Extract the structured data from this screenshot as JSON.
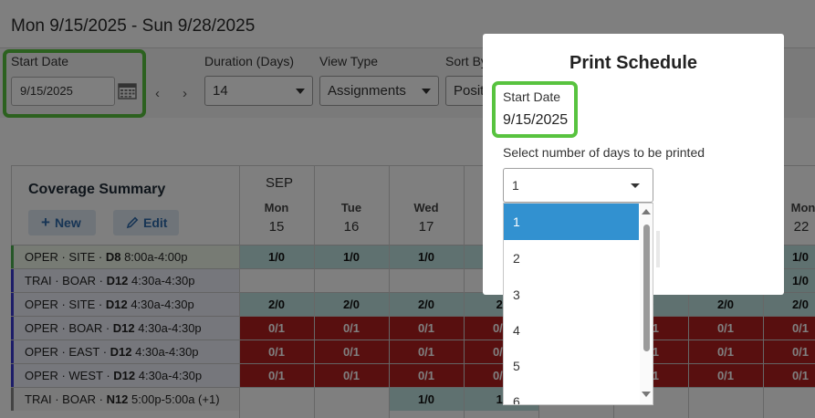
{
  "header": {
    "date_range": "Mon 9/15/2025  -  Sun 9/28/2025"
  },
  "filters": {
    "start_date_label": "Start Date",
    "start_date_value": "9/15/2025",
    "duration_label": "Duration (Days)",
    "duration_value": "14",
    "view_type_label": "View Type",
    "view_type_value": "Assignments",
    "sort_label": "Sort By",
    "sort_value": "Posit",
    "prev_arrow": "‹",
    "next_arrow": "›"
  },
  "coverage": {
    "title": "Coverage Summary",
    "new_label": "New",
    "edit_label": "Edit",
    "month": "SEP",
    "days": [
      {
        "dow": "Mon",
        "num": "15"
      },
      {
        "dow": "Tue",
        "num": "16"
      },
      {
        "dow": "Wed",
        "num": "17"
      },
      {
        "dow": "Mon",
        "num": "22"
      }
    ],
    "rows": [
      {
        "pre": "OPER · SITE · ",
        "code": "D8",
        "time": " 8:00a-4:00p",
        "bar": "#4caf50",
        "cells": [
          "1/0",
          "1/0",
          "1/0",
          "",
          "",
          "",
          "",
          "1/0"
        ],
        "status": "teal"
      },
      {
        "pre": "TRAI · BOAR · ",
        "code": "D12",
        "time": " 4:30a-4:30p",
        "bar": "#3a3ad0",
        "cells": [
          "",
          "",
          "",
          "",
          "",
          "",
          "",
          "1/0"
        ],
        "status": "mixed"
      },
      {
        "pre": "OPER · SITE · ",
        "code": "D12",
        "time": " 4:30a-4:30p",
        "bar": "#3a3ad0",
        "cells": [
          "2/0",
          "2/0",
          "2/0",
          "2/",
          "",
          "0",
          "2/0",
          "2/0"
        ],
        "status": "teal"
      },
      {
        "pre": "OPER · BOAR · ",
        "code": "D12",
        "time": " 4:30a-4:30p",
        "bar": "#3a3ad0",
        "cells": [
          "0/1",
          "0/1",
          "0/1",
          "0/1",
          "",
          "0/1",
          "0/1",
          "0/1"
        ],
        "status": "red"
      },
      {
        "pre": "OPER · EAST · ",
        "code": "D12",
        "time": " 4:30a-4:30p",
        "bar": "#3a3ad0",
        "cells": [
          "0/1",
          "0/1",
          "0/1",
          "0/1",
          "",
          "0/1",
          "0/1",
          "0/1"
        ],
        "status": "red"
      },
      {
        "pre": "OPER · WEST · ",
        "code": "D12",
        "time": " 4:30a-4:30p",
        "bar": "#3a3ad0",
        "cells": [
          "0/1",
          "0/1",
          "0/1",
          "0/1",
          "",
          "0/1",
          "0/1",
          "0/1"
        ],
        "status": "red"
      },
      {
        "pre": "TRAI · BOAR · ",
        "code": "N12",
        "time": " 5:00p-5:00a (+1)",
        "bar": "#888888",
        "cells": [
          "",
          "",
          "1/0",
          "1/",
          "",
          "",
          "",
          ""
        ],
        "status": "mixed"
      }
    ]
  },
  "modal": {
    "title": "Print Schedule",
    "start_date_label": "Start Date",
    "start_date_value": "9/15/2025",
    "days_prompt": "Select number of days to be printed",
    "days_selected": "1",
    "options": [
      "1",
      "2",
      "3",
      "4",
      "5",
      "6"
    ]
  },
  "colors": {
    "teal_cell": "#bfe3e0",
    "red_cell": "#b01f1f",
    "highlight": "#58c33f",
    "selected_option": "#3291d0",
    "accent_blue": "#2f6bab"
  }
}
